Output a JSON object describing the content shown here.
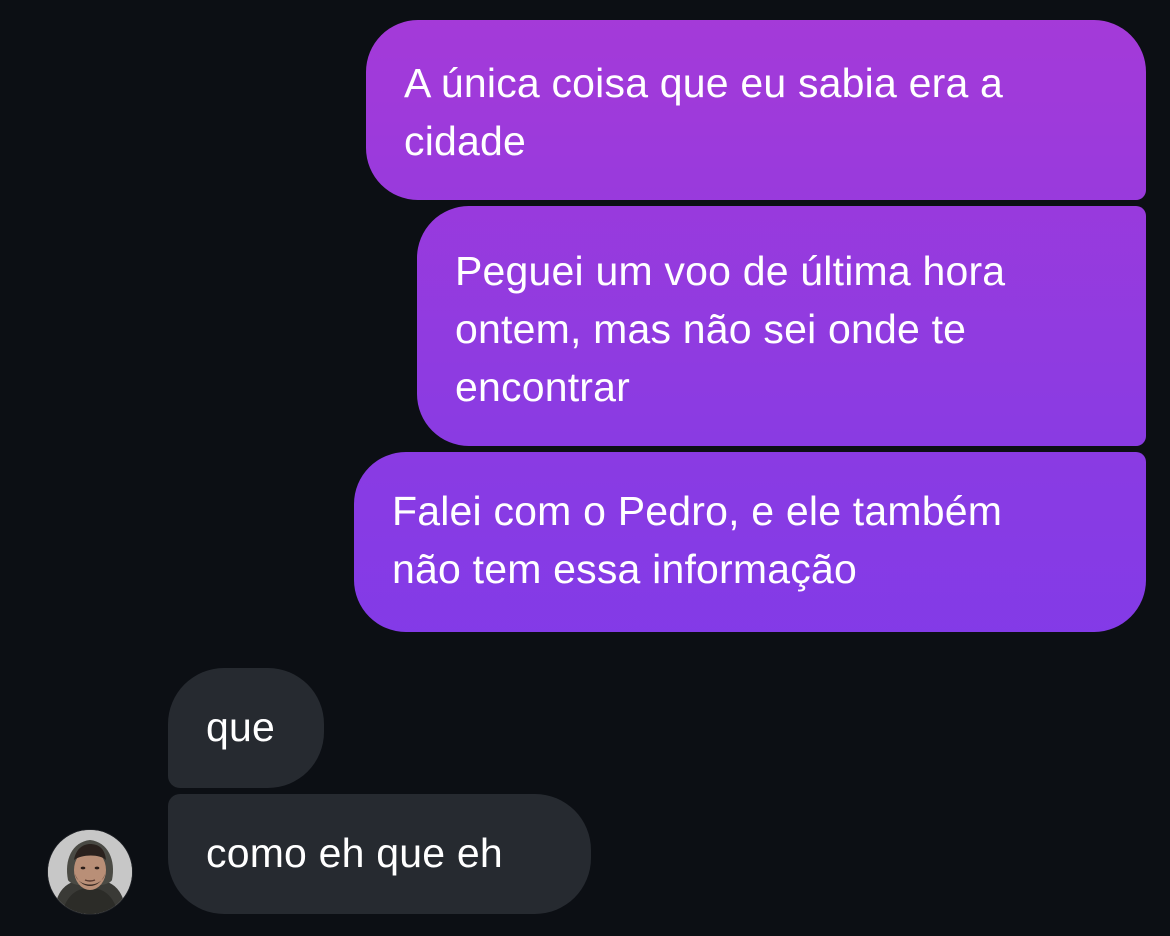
{
  "colors": {
    "background": "#0c0f14",
    "sent_gradient_top": "#a53ad8",
    "sent_gradient_bottom": "#783aee",
    "received_bubble": "#262a30",
    "text": "#ffffff"
  },
  "conversation": {
    "sent_messages": [
      {
        "text": "A única coisa que eu sabia era a\ncidade"
      },
      {
        "text": "Peguei um voo de última hora\nontem, mas não sei onde te\nencontrar"
      },
      {
        "text": "Falei com o Pedro, e ele também\nnão tem essa informação"
      }
    ],
    "received_messages": [
      {
        "text": "que"
      },
      {
        "text": "como eh que eh"
      }
    ],
    "contact": {
      "avatar_icon": "profile-photo"
    }
  }
}
